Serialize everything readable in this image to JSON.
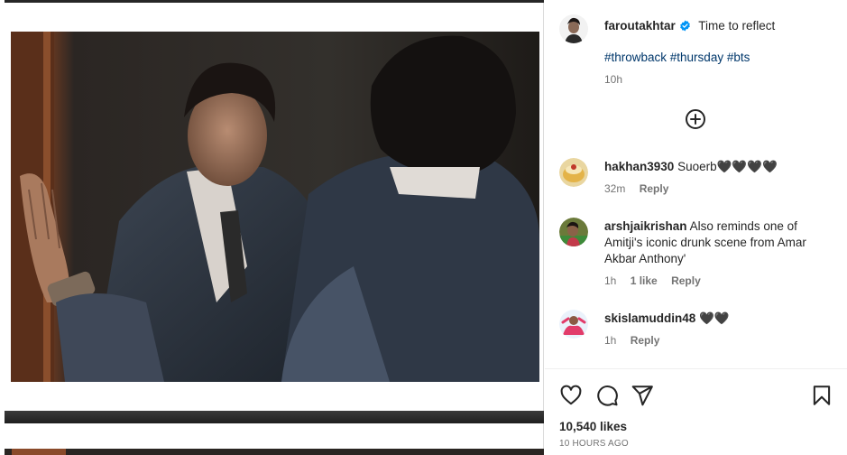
{
  "post": {
    "author": "faroutakhtar",
    "caption": "Time to reflect",
    "hashtags": "#throwback #thursday #bts",
    "age": "10h",
    "likes": "10,540 likes",
    "time_ago": "10 HOURS AGO"
  },
  "comments": [
    {
      "user": "hakhan3930",
      "text": "Suoerb🖤🖤🖤🖤",
      "age": "32m",
      "likes": "",
      "reply": "Reply"
    },
    {
      "user": "arshjaikrishan",
      "text": "Also reminds one of Amitji's iconic drunk scene from Amar Akbar Anthony'",
      "age": "1h",
      "likes": "1 like",
      "reply": "Reply"
    },
    {
      "user": "skislamuddin48",
      "text": "🖤🖤",
      "age": "1h",
      "likes": "",
      "reply": "Reply"
    }
  ],
  "icons": {
    "verified": "verified-badge-icon",
    "load_more": "plus-circle-icon",
    "like": "heart-icon",
    "comment": "comment-bubble-icon",
    "share": "paper-plane-icon",
    "save": "bookmark-icon"
  },
  "colors": {
    "link": "#00376b",
    "verified": "#0095f6",
    "muted": "#737373"
  }
}
